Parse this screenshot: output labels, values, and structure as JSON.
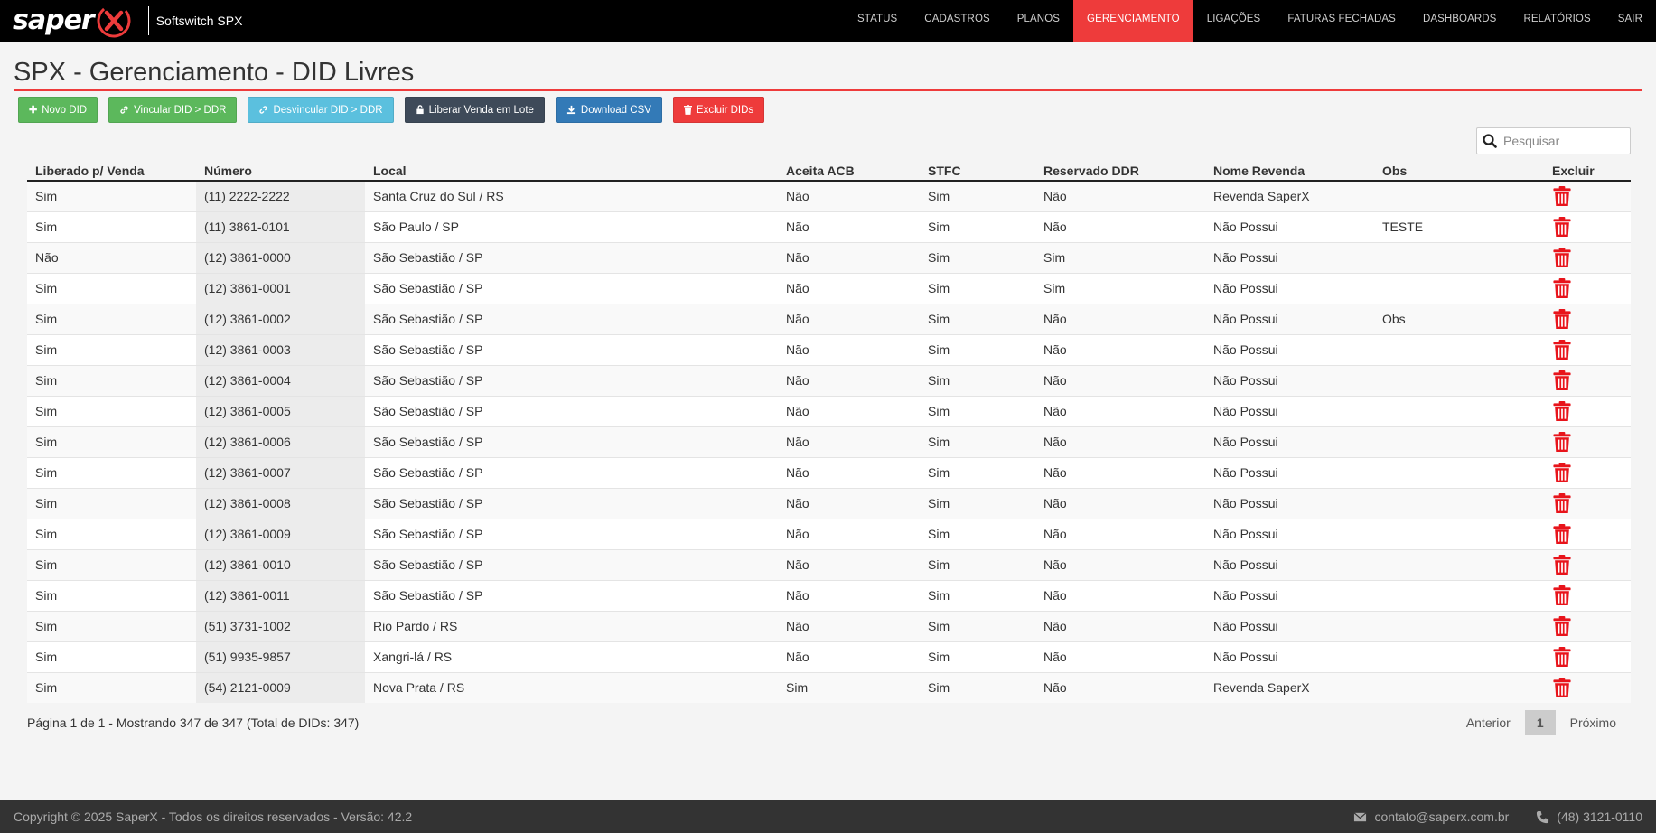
{
  "app": {
    "logo_text": "saper",
    "title": "Softswitch SPX"
  },
  "nav": [
    {
      "label": "STATUS",
      "active": false
    },
    {
      "label": "CADASTROS",
      "active": false
    },
    {
      "label": "PLANOS",
      "active": false
    },
    {
      "label": "GERENCIAMENTO",
      "active": true
    },
    {
      "label": "LIGAÇÕES",
      "active": false
    },
    {
      "label": "FATURAS FECHADAS",
      "active": false
    },
    {
      "label": "DASHBOARDS",
      "active": false
    },
    {
      "label": "RELATÓRIOS",
      "active": false
    },
    {
      "label": "SAIR",
      "active": false
    }
  ],
  "page_title": "SPX - Gerenciamento - DID Livres",
  "toolbar": {
    "novo_did": "Novo DID",
    "vincular": "Vincular DID > DDR",
    "desvincular": "Desvincular DID > DDR",
    "liberar": "Liberar Venda em Lote",
    "download": "Download CSV",
    "excluir": "Excluir DIDs"
  },
  "search": {
    "placeholder": "Pesquisar",
    "value": ""
  },
  "table": {
    "headers": [
      "Liberado p/ Venda",
      "Número",
      "Local",
      "Aceita ACB",
      "STFC",
      "Reservado DDR",
      "Nome Revenda",
      "Obs",
      "Excluir"
    ],
    "rows": [
      [
        "Sim",
        "(11) 2222-2222",
        "Santa Cruz do Sul / RS",
        "Não",
        "Sim",
        "Não",
        "Revenda SaperX",
        ""
      ],
      [
        "Sim",
        "(11) 3861-0101",
        "São Paulo / SP",
        "Não",
        "Sim",
        "Não",
        "Não Possui",
        "TESTE"
      ],
      [
        "Não",
        "(12) 3861-0000",
        "São Sebastião / SP",
        "Não",
        "Sim",
        "Sim",
        "Não Possui",
        ""
      ],
      [
        "Sim",
        "(12) 3861-0001",
        "São Sebastião / SP",
        "Não",
        "Sim",
        "Sim",
        "Não Possui",
        ""
      ],
      [
        "Sim",
        "(12) 3861-0002",
        "São Sebastião / SP",
        "Não",
        "Sim",
        "Não",
        "Não Possui",
        "Obs"
      ],
      [
        "Sim",
        "(12) 3861-0003",
        "São Sebastião / SP",
        "Não",
        "Sim",
        "Não",
        "Não Possui",
        ""
      ],
      [
        "Sim",
        "(12) 3861-0004",
        "São Sebastião / SP",
        "Não",
        "Sim",
        "Não",
        "Não Possui",
        ""
      ],
      [
        "Sim",
        "(12) 3861-0005",
        "São Sebastião / SP",
        "Não",
        "Sim",
        "Não",
        "Não Possui",
        ""
      ],
      [
        "Sim",
        "(12) 3861-0006",
        "São Sebastião / SP",
        "Não",
        "Sim",
        "Não",
        "Não Possui",
        ""
      ],
      [
        "Sim",
        "(12) 3861-0007",
        "São Sebastião / SP",
        "Não",
        "Sim",
        "Não",
        "Não Possui",
        ""
      ],
      [
        "Sim",
        "(12) 3861-0008",
        "São Sebastião / SP",
        "Não",
        "Sim",
        "Não",
        "Não Possui",
        ""
      ],
      [
        "Sim",
        "(12) 3861-0009",
        "São Sebastião / SP",
        "Não",
        "Sim",
        "Não",
        "Não Possui",
        ""
      ],
      [
        "Sim",
        "(12) 3861-0010",
        "São Sebastião / SP",
        "Não",
        "Sim",
        "Não",
        "Não Possui",
        ""
      ],
      [
        "Sim",
        "(12) 3861-0011",
        "São Sebastião / SP",
        "Não",
        "Sim",
        "Não",
        "Não Possui",
        ""
      ],
      [
        "Sim",
        "(51) 3731-1002",
        "Rio Pardo / RS",
        "Não",
        "Sim",
        "Não",
        "Não Possui",
        ""
      ],
      [
        "Sim",
        "(51) 9935-9857",
        "Xangri-lá / RS",
        "Não",
        "Sim",
        "Não",
        "Não Possui",
        ""
      ],
      [
        "Sim",
        "(54) 2121-0009",
        "Nova Prata / RS",
        "Sim",
        "Sim",
        "Não",
        "Revenda SaperX",
        ""
      ]
    ]
  },
  "page_info": "Página 1 de 1 - Mostrando 347 de 347 (Total de DIDs: 347)",
  "pagination": {
    "prev": "Anterior",
    "current": "1",
    "next": "Próximo"
  },
  "footer": {
    "copyright": "Copyright © 2025 SaperX - Todos os direitos reservados - Versão: 42.2",
    "email": "contato@saperx.com.br",
    "phone": "(48) 3121-0110"
  },
  "colors": {
    "accent": "#ee3b3b",
    "navbar": "#000000",
    "footer": "#333333"
  }
}
